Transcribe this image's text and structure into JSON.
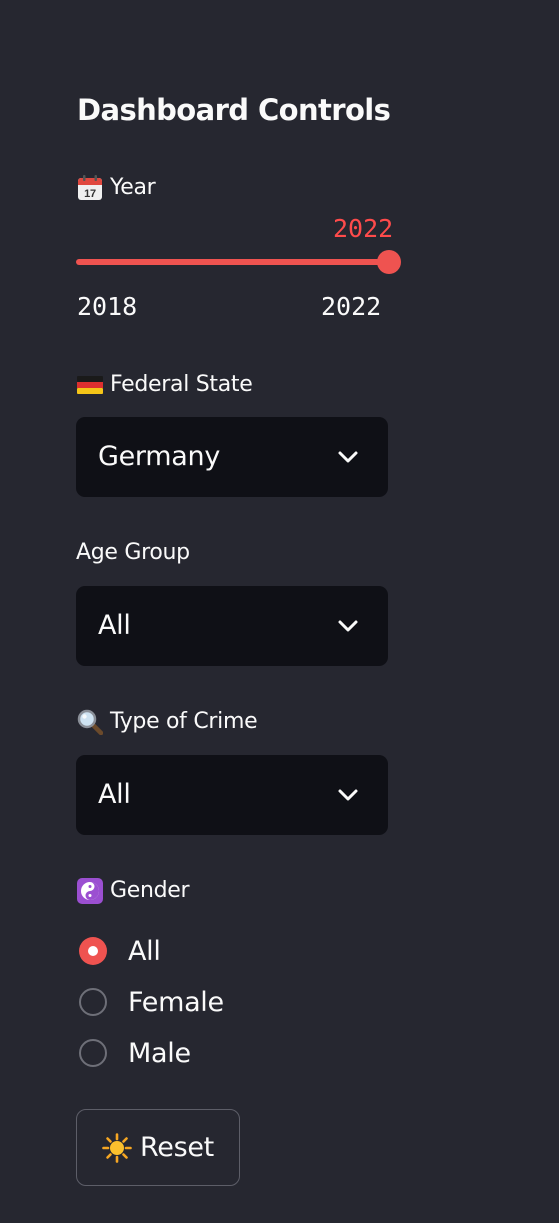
{
  "sidebar": {
    "title": "Dashboard Controls",
    "year": {
      "icon": "calendar-icon",
      "label": "Year",
      "value": "2022",
      "min": "2018",
      "max": "2022",
      "fraction": 1.0
    },
    "federal_state": {
      "icon": "germany-flag-icon",
      "label": "Federal State",
      "selected": "Germany"
    },
    "age_group": {
      "label": "Age Group",
      "selected": "All"
    },
    "crime_type": {
      "icon": "magnifying-glass-icon",
      "label": "Type of Crime",
      "selected": "All"
    },
    "gender": {
      "icon": "yin-yang-icon",
      "label": "Gender",
      "options": [
        "All",
        "Female",
        "Male"
      ],
      "selected": "All"
    },
    "reset": {
      "icon": "sun-icon",
      "label": "Reset"
    }
  },
  "colors": {
    "background": "#262730",
    "accent": "#ff4b4b",
    "select_background": "#0f1016",
    "text": "#fafafa"
  }
}
